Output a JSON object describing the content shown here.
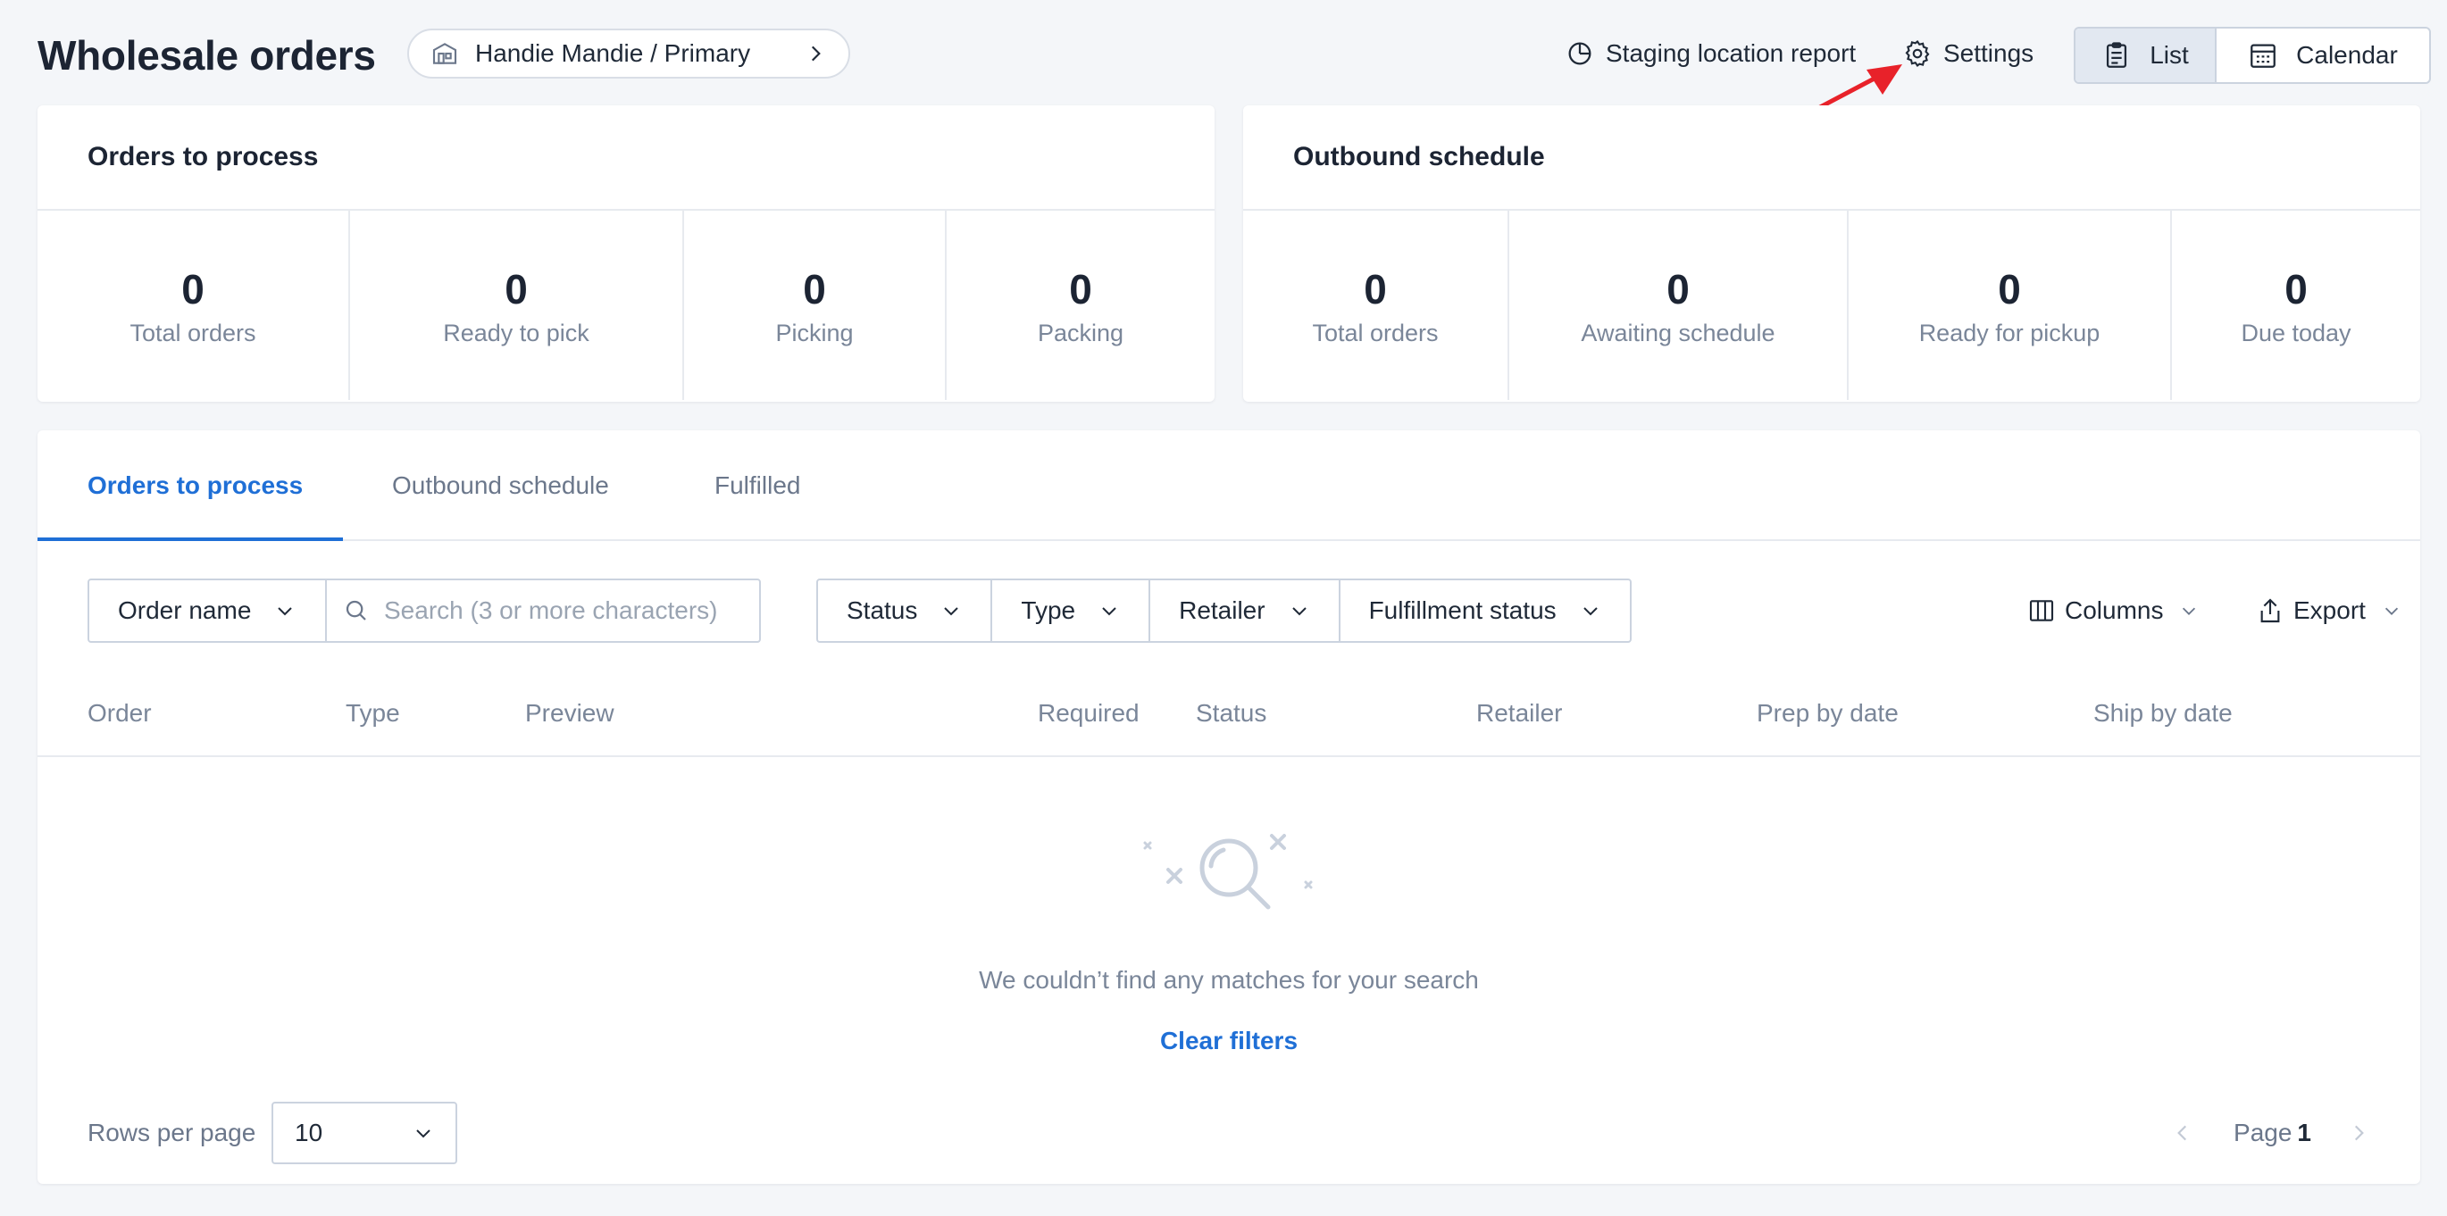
{
  "header": {
    "title": "Wholesale orders",
    "location": "Handie Mandie / Primary",
    "staging_report": "Staging location report",
    "settings": "Settings",
    "view_list": "List",
    "view_calendar": "Calendar"
  },
  "orders_to_process_card": {
    "title": "Orders to process",
    "stats": [
      {
        "value": "0",
        "label": "Total orders"
      },
      {
        "value": "0",
        "label": "Ready to pick"
      },
      {
        "value": "0",
        "label": "Picking"
      },
      {
        "value": "0",
        "label": "Packing"
      }
    ]
  },
  "outbound_schedule_card": {
    "title": "Outbound schedule",
    "stats": [
      {
        "value": "0",
        "label": "Total orders"
      },
      {
        "value": "0",
        "label": "Awaiting schedule"
      },
      {
        "value": "0",
        "label": "Ready for pickup"
      },
      {
        "value": "0",
        "label": "Due today"
      }
    ]
  },
  "tabs": [
    {
      "label": "Orders to process",
      "active": true
    },
    {
      "label": "Outbound schedule",
      "active": false
    },
    {
      "label": "Fulfilled",
      "active": false
    }
  ],
  "toolbar": {
    "search_field": "Order name",
    "search_placeholder": "Search (3 or more characters)",
    "filters": [
      "Status",
      "Type",
      "Retailer",
      "Fulfillment status"
    ],
    "columns": "Columns",
    "export": "Export"
  },
  "table": {
    "columns": [
      "Order",
      "Type",
      "Preview",
      "Required",
      "Status",
      "Retailer",
      "Prep by date",
      "Ship by date"
    ],
    "rows": []
  },
  "empty_state": {
    "message": "We couldn’t find any matches for your search",
    "action": "Clear filters"
  },
  "pagination": {
    "rows_per_page_label": "Rows per page",
    "rows_per_page": "10",
    "page_label": "Page",
    "page": "1"
  },
  "colors": {
    "accent": "#1f6fd6",
    "annotation": "#e8222a"
  }
}
